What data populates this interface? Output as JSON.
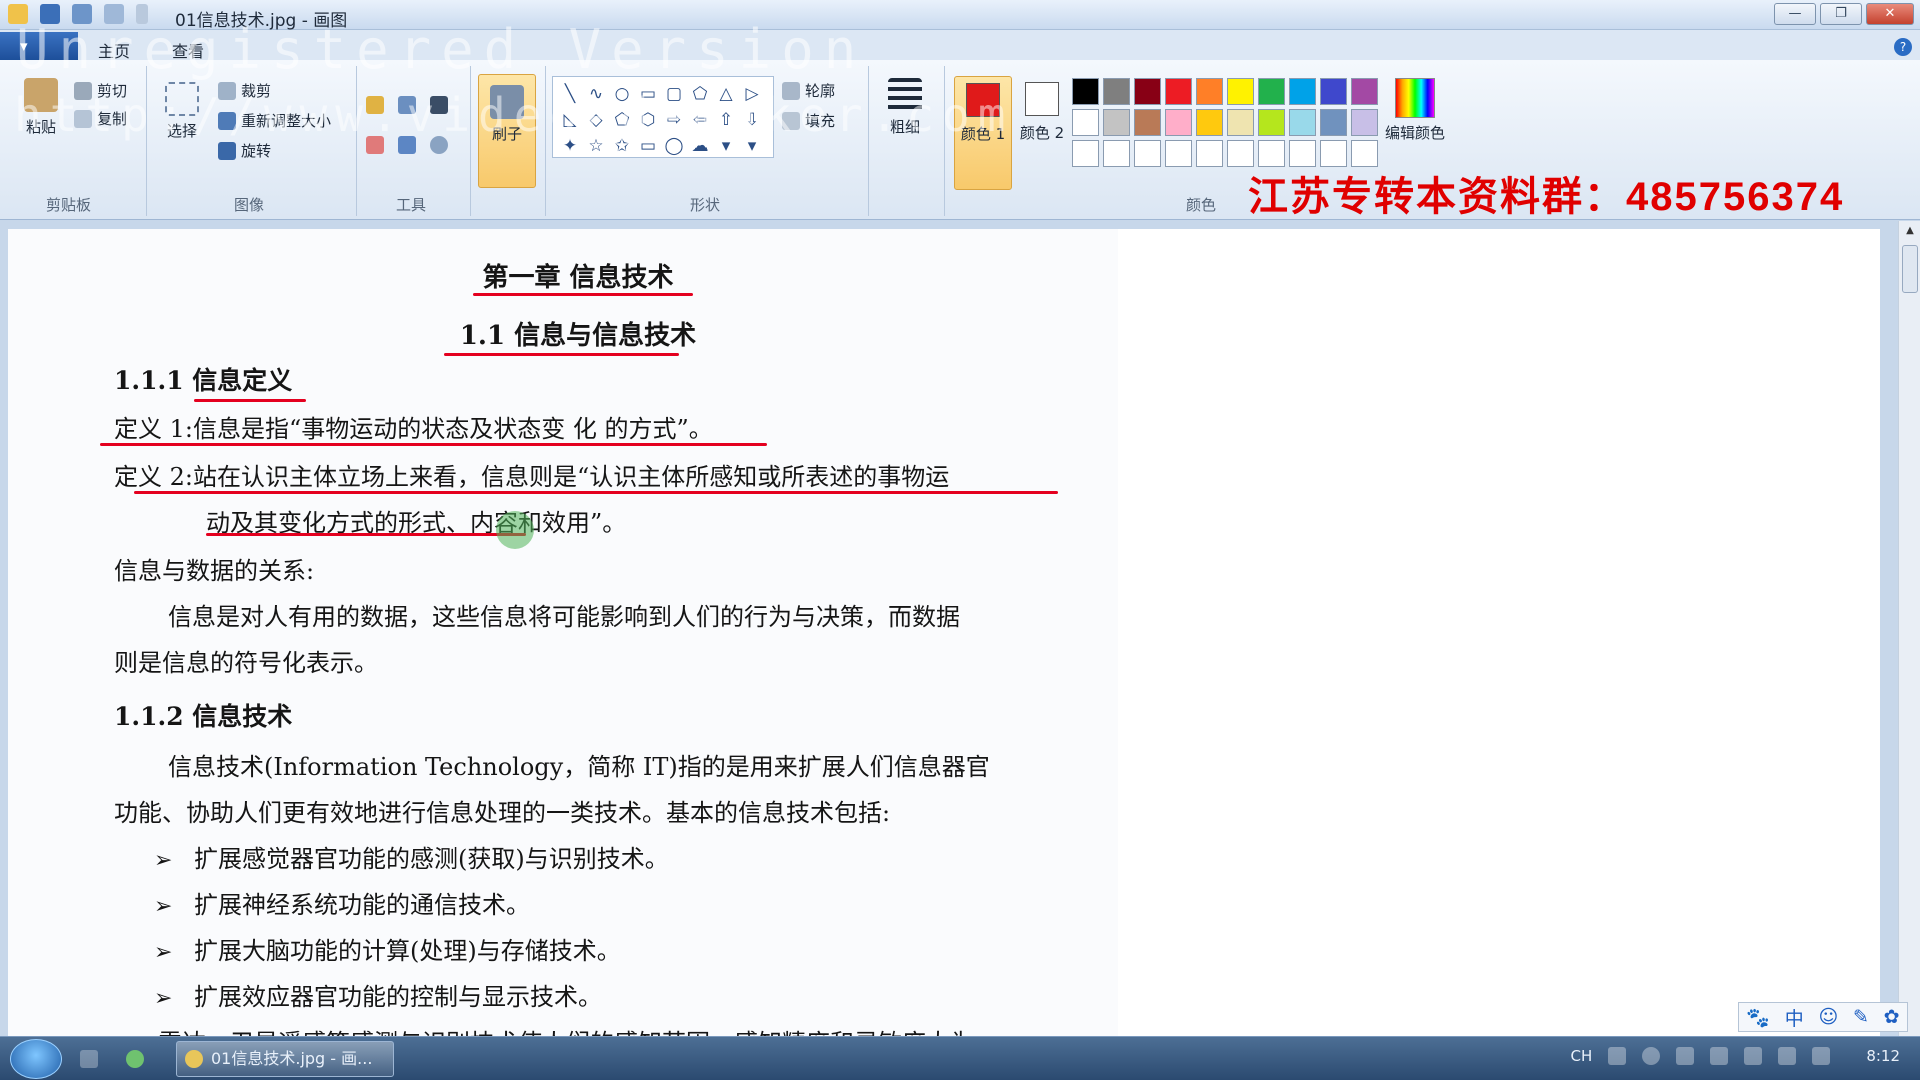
{
  "window": {
    "title": "01信息技术.jpg - 画图",
    "minimize": "—",
    "maximize": "❐",
    "close": "✕"
  },
  "watermark": {
    "line1": "Unregistered Version",
    "line2": "http://www.videoedemaker.com"
  },
  "tabs": {
    "file": "▾",
    "home": "主页",
    "view": "查看",
    "help": "?"
  },
  "ribbon": {
    "clipboard": {
      "paste": "粘贴",
      "cut": "剪切",
      "copy": "复制",
      "label": "剪贴板"
    },
    "image": {
      "select": "选择",
      "crop": "裁剪",
      "resize": "重新调整大小",
      "rotate": "旋转",
      "label": "图像"
    },
    "tools": {
      "label": "工具"
    },
    "brush": {
      "label": "刷子"
    },
    "shapes": {
      "outline": "轮廓",
      "fill": "填充",
      "label": "形状",
      "glyphs": [
        "╲",
        "∿",
        "○",
        "▭",
        "▢",
        "⬠",
        "△",
        "▷",
        "◺",
        "◇",
        "⬠",
        "⬡",
        "⇨",
        "⇦",
        "⇧",
        "⇩",
        "✦",
        "☆",
        "✩",
        "▭",
        "◯",
        "☁",
        "▾",
        "▾"
      ]
    },
    "size": {
      "label": "粗细"
    },
    "color1": {
      "label": "颜色 1",
      "value": "#e01a1a"
    },
    "color2": {
      "label": "颜色 2",
      "value": "#ffffff"
    },
    "colors": {
      "label": "颜色",
      "edit": "编辑颜色",
      "palette": [
        "#000000",
        "#7f7f7f",
        "#880015",
        "#ed1c24",
        "#ff7f27",
        "#fff200",
        "#22b14c",
        "#00a2e8",
        "#3f48cc",
        "#a349a4",
        "#ffffff",
        "#c3c3c3",
        "#b97a57",
        "#ffaec9",
        "#ffc90e",
        "#efe4b0",
        "#b5e61d",
        "#99d9ea",
        "#7092be",
        "#c8bfe7",
        "#ffffff",
        "#ffffff",
        "#ffffff",
        "#ffffff",
        "#ffffff",
        "#ffffff",
        "#ffffff",
        "#ffffff",
        "#ffffff",
        "#ffffff"
      ]
    }
  },
  "promo": {
    "text": "江苏专转本资料群：",
    "number": "485756374"
  },
  "document": {
    "chapter": "第一章 信息技术",
    "section": "1.1 信息与信息技术",
    "sub1": "1.1.1 信息定义",
    "def1": "定义 1:信息是指“事物运动的状态及状态变 化 的方式”。",
    "def2_line1": "定义 2:站在认识主体立场上来看，信息则是“认识主体所感知或所表述的事物运",
    "def2_line2": "动及其变化方式的形式、内容和效用”。",
    "relation_title": "信息与数据的关系:",
    "relation_line1": "信息是对人有用的数据，这些信息将可能影响到人们的行为与决策，而数据",
    "relation_line2": "则是信息的符号化表示。",
    "sub2": "1.1.2 信息技术",
    "it_line1": "信息技术(Information Technology，简称 IT)指的是用来扩展人们信息器官",
    "it_line2": "功能、协助人们更有效地进行信息处理的一类技术。基本的信息技术包括:",
    "bullets": [
      "扩展感觉器官功能的感测(获取)与识别技术。",
      "扩展神经系统功能的通信技术。",
      "扩展大脑功能的计算(处理)与存储技术。",
      "扩展效应器官功能的控制与显示技术。"
    ],
    "bullet_mark": "➢",
    "partial_line": "雷达、卫星遥感等感测与识别技术使人们的感知范围、感知精度和灵敏度大为"
  },
  "ime": [
    "🐾",
    "中",
    "☺",
    "✎",
    "✿"
  ],
  "taskbar": {
    "task_label": "01信息技术.jpg - 画...",
    "tray_lang": "CH",
    "clock": "8:12"
  }
}
